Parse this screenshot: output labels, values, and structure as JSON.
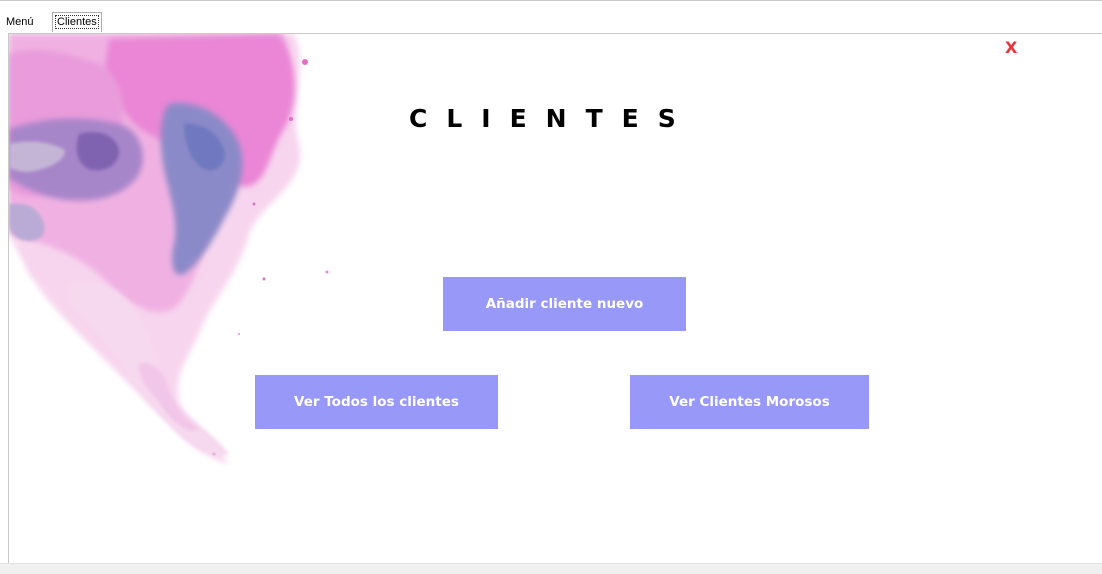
{
  "tabs": [
    {
      "label": "Menú",
      "active": false
    },
    {
      "label": "Clientes",
      "active": true
    }
  ],
  "page": {
    "title": "CLIENTES",
    "close_label": "X"
  },
  "buttons": {
    "add_client": "Añadir cliente nuevo",
    "view_all": "Ver Todos los clientes",
    "view_overdue": "Ver Clientes Morosos"
  },
  "colors": {
    "button_bg": "#9898f8",
    "close": "#e6343a",
    "splash_pink": "#e98fd8",
    "splash_purple": "#9a86c9"
  },
  "decoration": {
    "splash_icon": "watercolor-splash"
  }
}
